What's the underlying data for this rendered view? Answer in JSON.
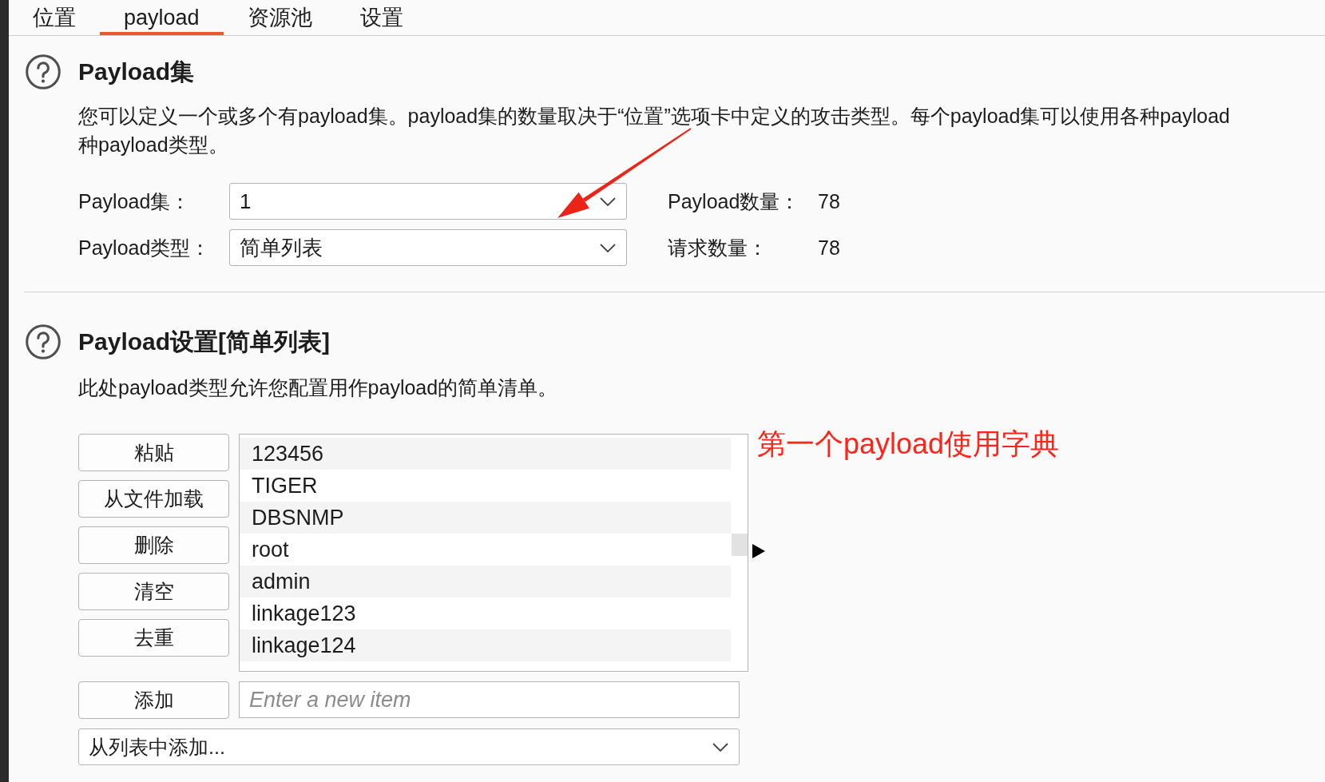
{
  "tabs": [
    {
      "label": "位置",
      "selected": false
    },
    {
      "label": "payload",
      "selected": true
    },
    {
      "label": "资源池",
      "selected": false
    },
    {
      "label": "设置",
      "selected": false
    }
  ],
  "payload_sets_section": {
    "title": "Payload集",
    "description": "您可以定义一个或多个有payload集。payload集的数量取决于“位置”选项卡中定义的攻击类型。每个payload集可以使用各种payload\n种payload类型。",
    "fields": [
      {
        "label": "Payload集：",
        "value": "1"
      },
      {
        "label": "Payload类型：",
        "value": "简单列表"
      }
    ],
    "stats": [
      {
        "label": "Payload数量：",
        "value": "78"
      },
      {
        "label": "请求数量：",
        "value": "78"
      }
    ]
  },
  "payload_settings_section": {
    "title": "Payload设置[简单列表]",
    "description": "此处payload类型允许您配置用作payload的简单清单。",
    "buttons": [
      "粘贴",
      "从文件加载",
      "删除",
      "清空",
      "去重"
    ],
    "list_items": [
      {
        "text": "123456",
        "selected": false
      },
      {
        "text": "TIGER",
        "selected": false
      },
      {
        "text": "DBSNMP",
        "selected": false
      },
      {
        "text": "root",
        "selected": false
      },
      {
        "text": "admin",
        "selected": false
      },
      {
        "text": "linkage123",
        "selected": false
      },
      {
        "text": "linkage124",
        "selected": false
      }
    ],
    "add_button": "添加",
    "new_item_field": {
      "placeholder": "Enter a new item"
    },
    "add_from_list": {
      "value": "从列表中添加..."
    }
  },
  "annotation": {
    "text": "第一个payload使用字典"
  }
}
